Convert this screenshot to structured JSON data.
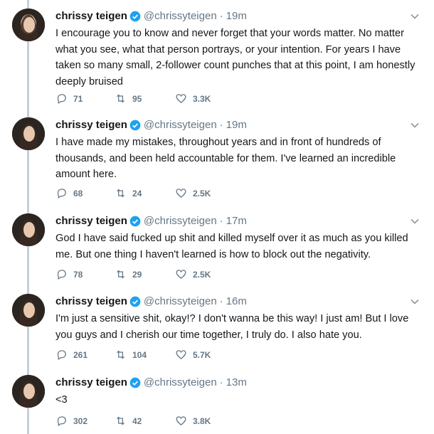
{
  "author": {
    "name": "chrissy teigen",
    "handle": "@chrissyteigen",
    "dot": "·"
  },
  "tweets": [
    {
      "time": "19m",
      "text": "I encourage you to know and never forget that your words matter. No matter what you see, what that person portrays, or your intention. For years I have taken so many small, 2-follower count punches that at this point, I am honestly deeply bruised",
      "replies": "71",
      "retweets": "95",
      "likes": "3.3K"
    },
    {
      "time": "19m",
      "text": "I have made my mistakes, throughout years and in front of hundreds of thousands, and been held accountable for them. I've learned an incredible amount here.",
      "replies": "68",
      "retweets": "24",
      "likes": "2.5K"
    },
    {
      "time": "17m",
      "text": "God I have said fucked up shit and killed myself over it as much as you killed me. But one thing I haven't learned is how to block out the negativity.",
      "replies": "78",
      "retweets": "29",
      "likes": "2.5K"
    },
    {
      "time": "16m",
      "text": "I'm just a sensitive shit, okay!? I don't wanna be this way! I just am! But I love you guys and I cherish our time together, I truly do. I also hate you.",
      "replies": "261",
      "retweets": "104",
      "likes": "5.7K"
    },
    {
      "time": "13m",
      "text": "<3",
      "replies": "302",
      "retweets": "42",
      "likes": "3.8K"
    }
  ],
  "colors": {
    "text": "#14171a",
    "muted": "#657786",
    "verified": "#1da1f2",
    "thread_line": "#c4cfd6"
  },
  "icons": [
    "avatar",
    "verified-badge-icon",
    "chevron-down-icon",
    "reply-icon",
    "retweet-icon",
    "like-icon"
  ]
}
